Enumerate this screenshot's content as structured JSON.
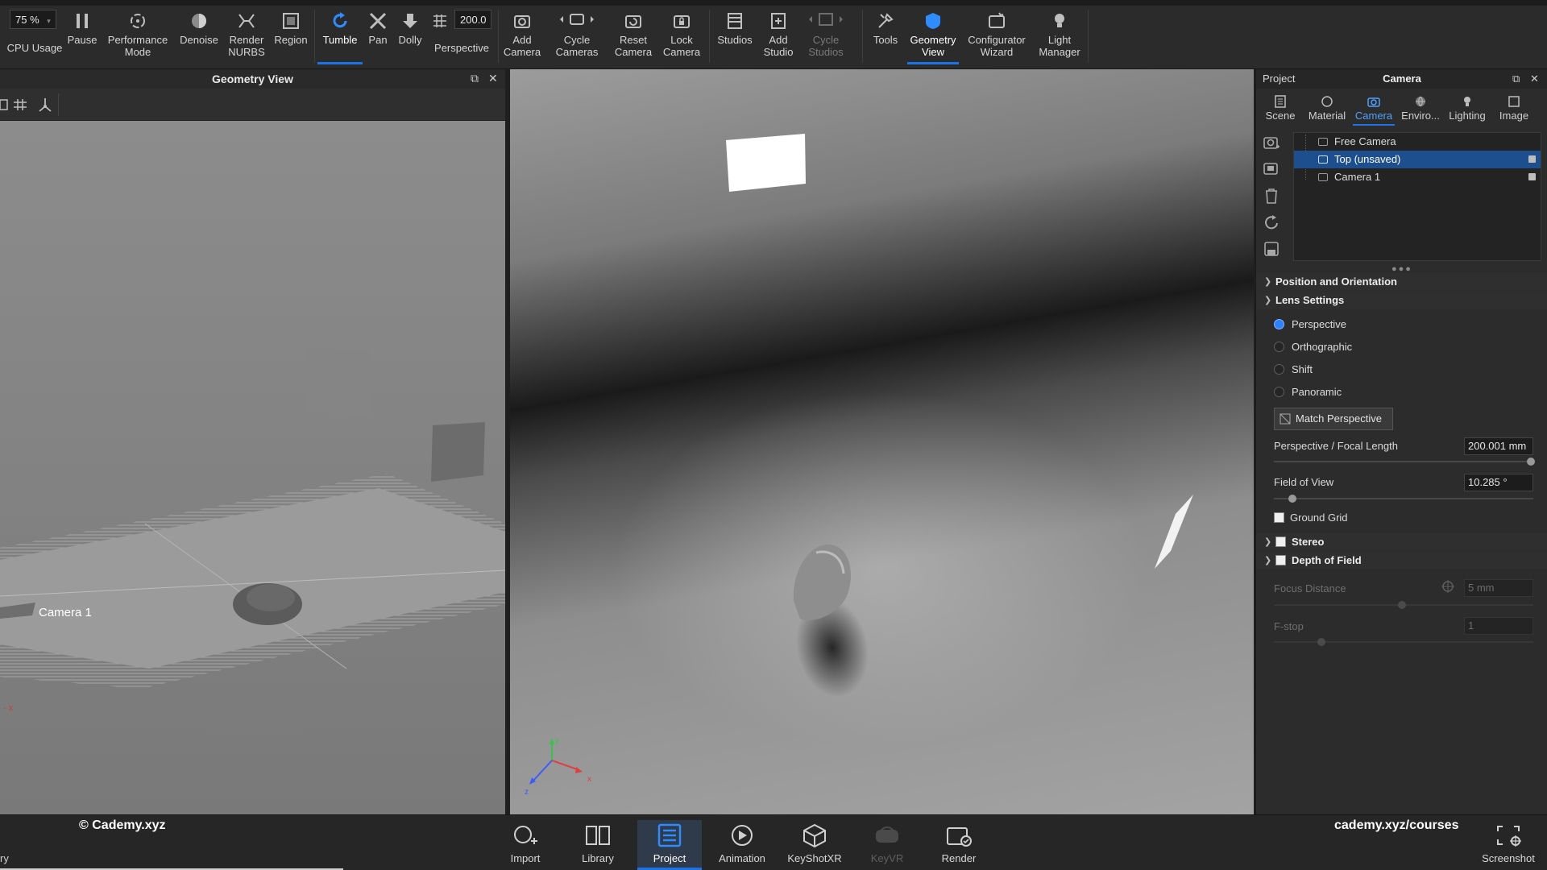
{
  "toolbar": {
    "zoom_value": "75 %",
    "perspective_value": "200.0",
    "items": {
      "cpu_usage": "CPU Usage",
      "pause": "Pause",
      "performance_mode": [
        "Performance",
        "Mode"
      ],
      "denoise": "Denoise",
      "render_nurbs": [
        "Render",
        "NURBS"
      ],
      "region": "Region",
      "tumble": "Tumble",
      "pan": "Pan",
      "dolly": "Dolly",
      "perspective": "Perspective",
      "add_camera": [
        "Add",
        "Camera"
      ],
      "cycle_cameras": [
        "Cycle",
        "Cameras"
      ],
      "reset_camera": [
        "Reset",
        "Camera"
      ],
      "lock_camera": [
        "Lock",
        "Camera"
      ],
      "studios": "Studios",
      "add_studio": [
        "Add",
        "Studio"
      ],
      "cycle_studios": [
        "Cycle",
        "Studios"
      ],
      "tools": "Tools",
      "geometry_view": [
        "Geometry",
        "View"
      ],
      "configurator_wizard": [
        "Configurator",
        "Wizard"
      ],
      "light_manager": [
        "Light",
        "Manager"
      ]
    }
  },
  "geometry_view": {
    "title": "Geometry View",
    "camera_label": "Camera 1",
    "watermark": "© Cademy.xyz"
  },
  "viewport": {
    "axis_labels": {
      "x": "x",
      "y": "y",
      "z": "z"
    }
  },
  "panel": {
    "left_title": "Project",
    "title": "Camera",
    "tabs": [
      "Scene",
      "Material",
      "Camera",
      "Enviro...",
      "Lighting",
      "Image"
    ],
    "active_tab": "Camera",
    "cameras": [
      {
        "name": "Free Camera",
        "selected": false,
        "locked": false
      },
      {
        "name": "Top (unsaved)",
        "selected": true,
        "locked": true
      },
      {
        "name": "Camera 1",
        "selected": false,
        "locked": true
      }
    ],
    "sections": {
      "position": "Position and Orientation",
      "lens": "Lens Settings",
      "stereo": "Stereo",
      "dof": "Depth of Field"
    },
    "lens_modes": [
      "Perspective",
      "Orthographic",
      "Shift",
      "Panoramic"
    ],
    "selected_lens_mode": "Perspective",
    "match_perspective": "Match Perspective",
    "focal_length": {
      "label": "Perspective / Focal Length",
      "value": "200.001 mm"
    },
    "field_of_view": {
      "label": "Field of View",
      "value": "10.285 °"
    },
    "ground_grid": {
      "label": "Ground Grid",
      "checked": false
    },
    "focus_distance": {
      "label": "Focus Distance",
      "value": "5 mm"
    },
    "fstop": {
      "label": "F-stop",
      "value": "1"
    },
    "course_watermark": "cademy.xyz/courses"
  },
  "dock": {
    "items": [
      "Import",
      "Library",
      "Project",
      "Animation",
      "KeyShotXR",
      "KeyVR",
      "Render"
    ],
    "active": "Project",
    "disabled": [
      "KeyVR"
    ],
    "screenshot": "Screenshot",
    "left_fragment": "ry"
  },
  "colors": {
    "accent": "#1a73e8",
    "selection": "#1d4f8f",
    "toolbar_bg": "#2b2b2b",
    "panel_bg": "#2c2c2c"
  }
}
